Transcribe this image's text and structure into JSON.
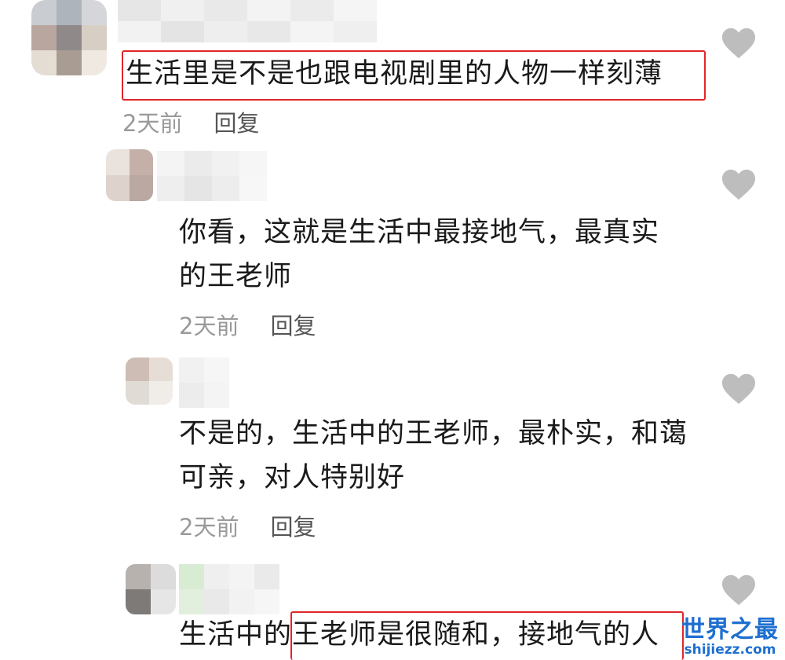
{
  "comments": [
    {
      "text": "生活里是不是也跟电视剧里的人物一样刻薄",
      "time": "2天前",
      "reply_label": "回复"
    },
    {
      "text_line1": "你看，这就是生活中最接地气，最真实",
      "text_line2": "的王老师",
      "time": "2天前",
      "reply_label": "回复"
    },
    {
      "text_line1": "不是的，生活中的王老师，最朴实，和蔼",
      "text_line2": "可亲，对人特别好",
      "time": "2天前",
      "reply_label": "回复"
    },
    {
      "text": "生活中的王老师是很随和，接地气的人"
    }
  ],
  "watermark": {
    "title": "世界之最",
    "domain": "shijiezz.com"
  },
  "colors": {
    "highlight_border": "#e0262a",
    "heart": "#bdbdbd",
    "watermark": "#1e6fd0"
  }
}
